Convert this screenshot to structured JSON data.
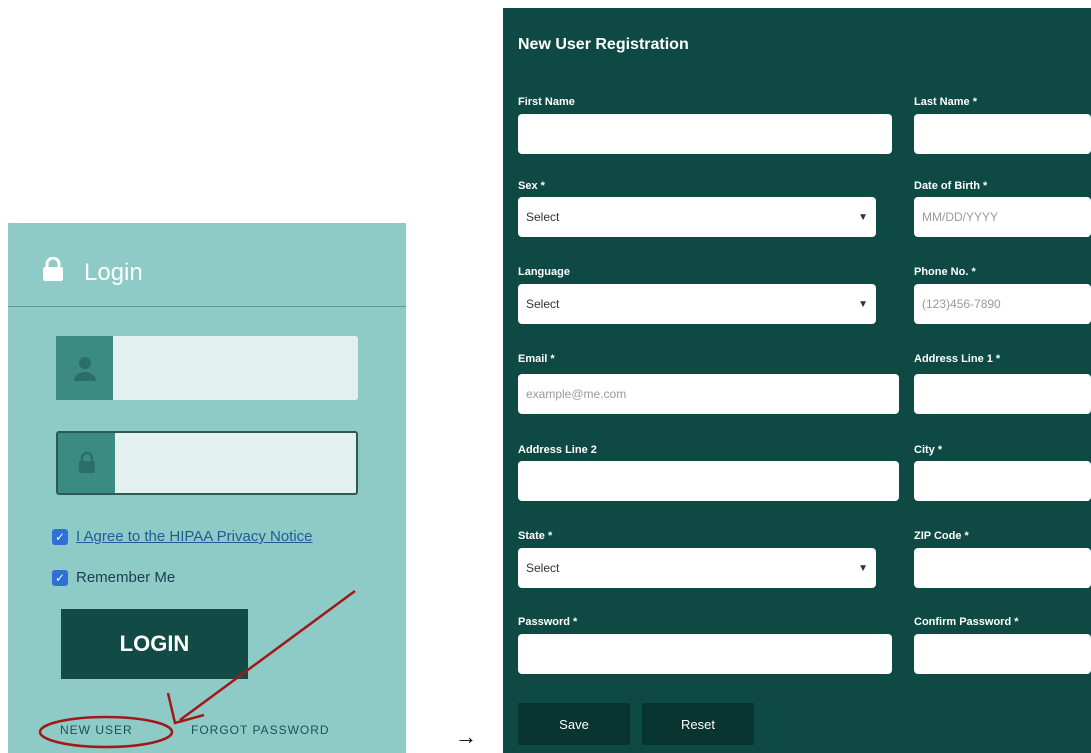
{
  "login": {
    "title": "Login",
    "agree_text": "I Agree to the HIPAA Privacy Notice",
    "remember_text": "Remember Me",
    "login_button": "LOGIN",
    "new_user_link": "NEW USER",
    "forgot_link": "FORGOT PASSWORD",
    "agree_checked": true,
    "remember_checked": true
  },
  "flow_arrow": "→",
  "registration": {
    "title": "New User Registration",
    "first_name_label": "First Name",
    "last_name_label": "Last Name *",
    "sex_label": "Sex *",
    "sex_value": "Select",
    "dob_label": "Date of Birth *",
    "dob_placeholder": "MM/DD/YYYY",
    "language_label": "Language",
    "language_value": "Select",
    "phone_label": "Phone No. *",
    "phone_placeholder": "(123)456-7890",
    "email_label": "Email *",
    "email_placeholder": "example@me.com",
    "address1_label": "Address Line 1 *",
    "address2_label": "Address Line 2",
    "city_label": "City *",
    "state_label": "State *",
    "state_value": "Select",
    "zip_label": "ZIP Code *",
    "password_label": "Password *",
    "confirm_password_label": "Confirm Password *",
    "save_button": "Save",
    "reset_button": "Reset"
  },
  "colors": {
    "login_bg": "#8ecbc6",
    "login_button": "#124a45",
    "registration_bg": "#0e4a43",
    "annotation": "#a01818"
  }
}
